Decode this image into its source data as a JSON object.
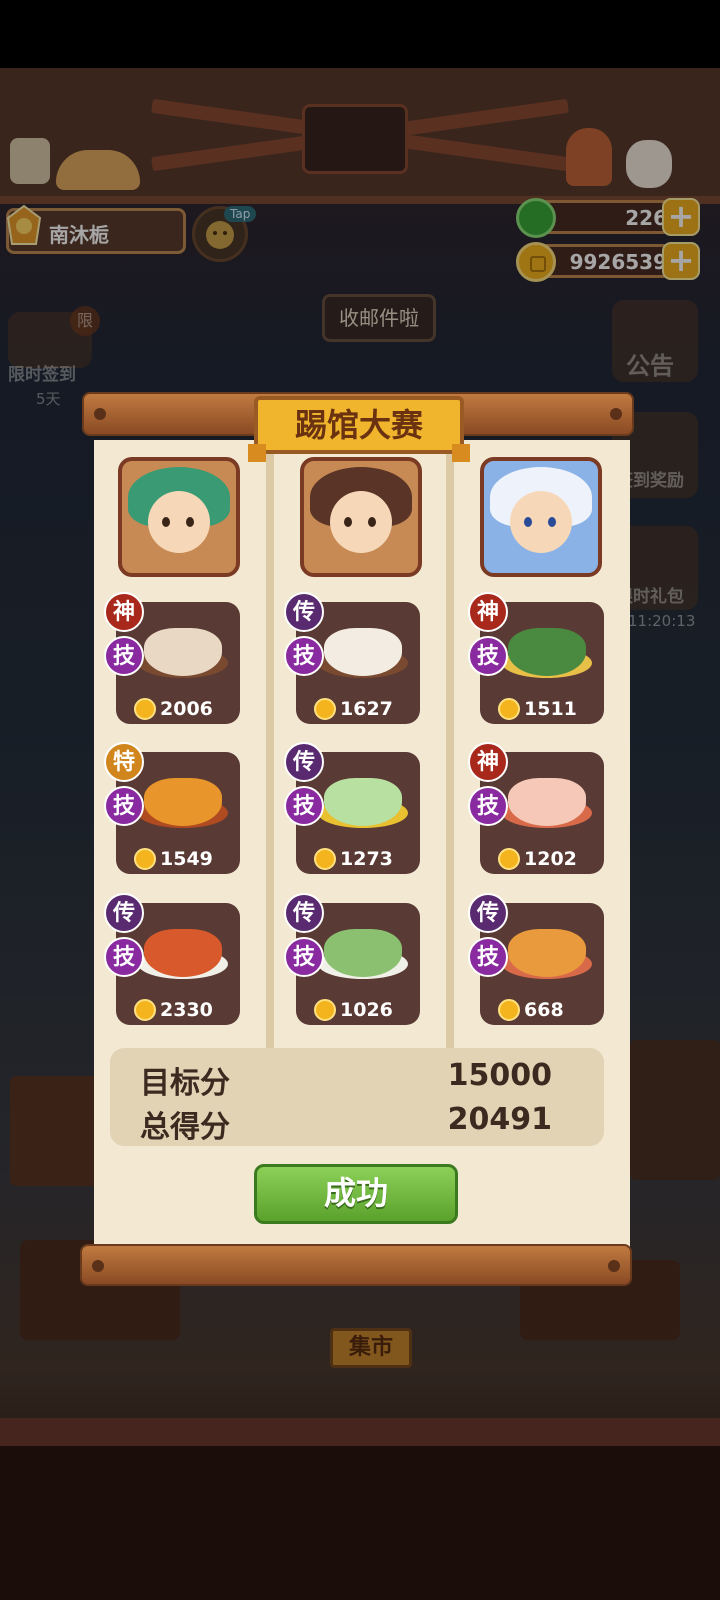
{
  "player": {
    "name": "南沐栀",
    "tap_label": "Tap"
  },
  "currency": {
    "jade": "226",
    "coins": "9926539"
  },
  "side_left": {
    "checkin_label": "限时签到",
    "checkin_days": "5天",
    "checkin_badge": "限"
  },
  "side_right": {
    "notice_label": "公告",
    "signin_reward_label": "签到奖励",
    "gift_label": "限时礼包",
    "gift_timer": "11:20:13"
  },
  "mail_bubble": "收邮件啦",
  "modal": {
    "title": "踢馆大赛",
    "columns": [
      {
        "dishes": [
          {
            "rank": "神",
            "skill": "技",
            "score": "2006"
          },
          {
            "rank": "特",
            "skill": "技",
            "score": "1549"
          },
          {
            "rank": "传",
            "skill": "技",
            "score": "2330"
          }
        ]
      },
      {
        "dishes": [
          {
            "rank": "传",
            "skill": "技",
            "score": "1627"
          },
          {
            "rank": "传",
            "skill": "技",
            "score": "1273"
          },
          {
            "rank": "传",
            "skill": "技",
            "score": "1026"
          }
        ]
      },
      {
        "dishes": [
          {
            "rank": "神",
            "skill": "技",
            "score": "1511"
          },
          {
            "rank": "神",
            "skill": "技",
            "score": "1202"
          },
          {
            "rank": "传",
            "skill": "技",
            "score": "668"
          }
        ]
      }
    ],
    "target_label": "目标分",
    "target_value": "15000",
    "total_label": "总得分",
    "total_value": "20491",
    "result_button": "成功"
  },
  "market_sign": "集市",
  "colors": {
    "god": "#a8281c",
    "legend": "#5a2a70",
    "special": "#d0861c",
    "skill": "#8a2aa0",
    "success": "#6ab83a"
  }
}
